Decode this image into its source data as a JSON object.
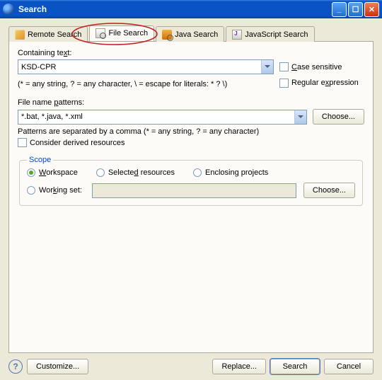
{
  "window": {
    "title": "Search"
  },
  "tabs": {
    "remote": "Remote Search",
    "file": "File Search",
    "java": "Java Search",
    "js": "JavaScript Search"
  },
  "containing": {
    "label": "Containing text:",
    "value": "KSD-CPR",
    "hint": "(* = any string, ? = any character, \\ = escape for literals: * ? \\)"
  },
  "checks": {
    "case": "Case sensitive",
    "regex": "Regular expression",
    "derived": "Consider derived resources"
  },
  "patterns": {
    "label": "File name patterns:",
    "value": "*.bat, *.java, *.xml",
    "choose": "Choose...",
    "hint": "Patterns are separated by a comma (* = any string, ? = any character)"
  },
  "scope": {
    "legend": "Scope",
    "workspace": "Workspace",
    "selected": "Selected resources",
    "enclosing": "Enclosing projects",
    "workingset": "Working set:",
    "choose": "Choose..."
  },
  "buttons": {
    "customize": "Customize...",
    "replace": "Replace...",
    "search": "Search",
    "cancel": "Cancel"
  }
}
